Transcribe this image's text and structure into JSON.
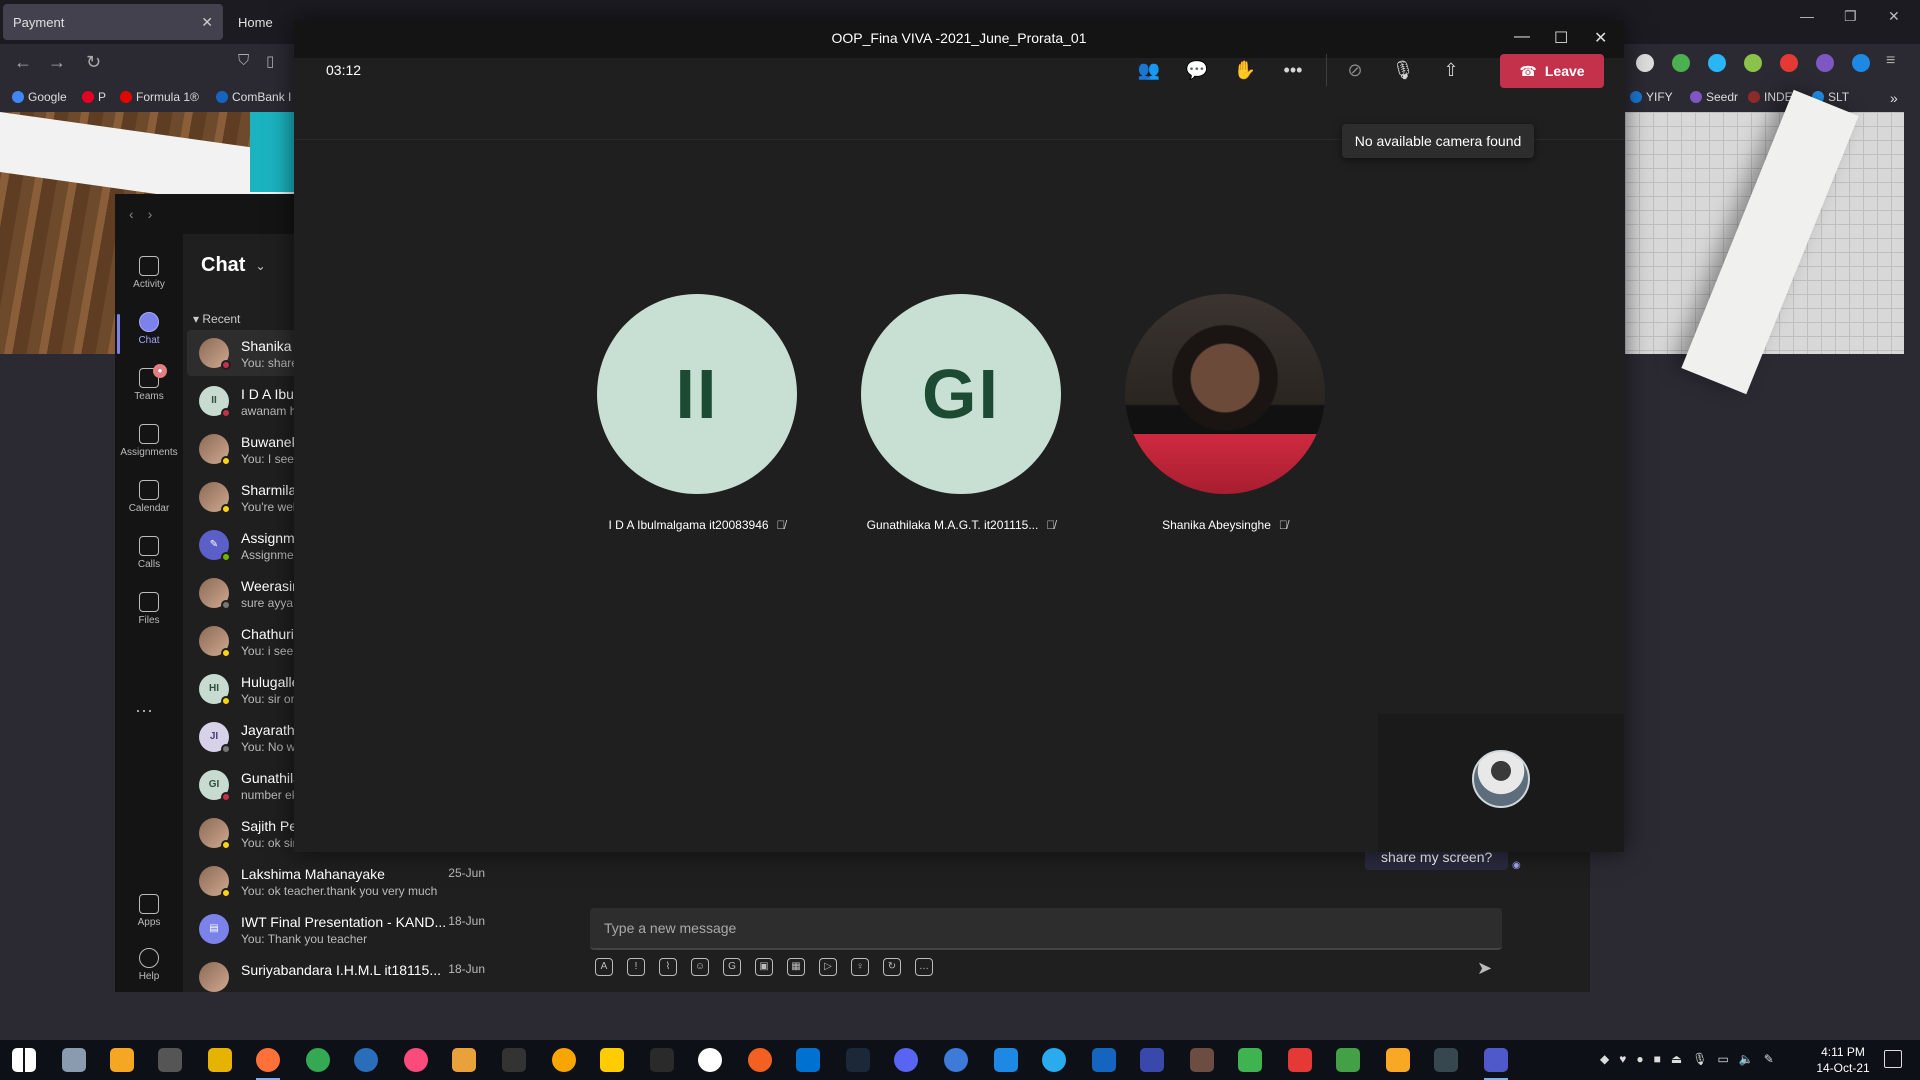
{
  "browser": {
    "tabs": [
      {
        "label": "Payment",
        "active": true
      },
      {
        "label": "Home",
        "active": false
      }
    ],
    "bookmarks_left": [
      "Google",
      "P",
      "Formula 1®",
      "ComBank I"
    ],
    "bookmarks_right": [
      "YIFY",
      "Seedr",
      "INDEX",
      "SLT"
    ]
  },
  "teams": {
    "rail": [
      {
        "label": "Activity"
      },
      {
        "label": "Chat"
      },
      {
        "label": "Teams"
      },
      {
        "label": "Assignments"
      },
      {
        "label": "Calendar"
      },
      {
        "label": "Calls"
      },
      {
        "label": "Files"
      }
    ],
    "rail_more": "···",
    "rail_bottom": [
      {
        "label": "Apps"
      },
      {
        "label": "Help"
      }
    ],
    "chat_title": "Chat",
    "recent_label": "Recent",
    "chats": [
      {
        "name": "Shanika A",
        "preview": "You: share",
        "initials": "",
        "date": ""
      },
      {
        "name": "I D A Ibu",
        "preview": "awanam h",
        "initials": "II",
        "date": ""
      },
      {
        "name": "Buwanek",
        "preview": "You: I see .",
        "initials": "",
        "date": ""
      },
      {
        "name": "Sharmila",
        "preview": "You're wel",
        "initials": "",
        "date": ""
      },
      {
        "name": "Assignme",
        "preview": "Assignmer",
        "initials": "",
        "date": ""
      },
      {
        "name": "Weerasin",
        "preview": "sure ayya",
        "initials": "",
        "date": ""
      },
      {
        "name": "Chathuril",
        "preview": "You: i see,T",
        "initials": "",
        "date": ""
      },
      {
        "name": "Hulugalle",
        "preview": "You: sir on",
        "initials": "HI",
        "date": ""
      },
      {
        "name": "Jayarathr",
        "preview": "You: No w",
        "initials": "JI",
        "date": ""
      },
      {
        "name": "Gunathila",
        "preview": "number ek",
        "initials": "GI",
        "date": ""
      },
      {
        "name": "Sajith Per",
        "preview": "You: ok sir",
        "initials": "",
        "date": ""
      },
      {
        "name": "Lakshima Mahanayake",
        "preview": "You: ok teacher.thank you very much",
        "initials": "",
        "date": "25-Jun"
      },
      {
        "name": "IWT Final Presentation - KAND...",
        "preview": "You: Thank you teacher",
        "initials": "",
        "date": "18-Jun"
      },
      {
        "name": "Suriyabandara I.H.M.L it18115...",
        "preview": "",
        "initials": "",
        "date": "18-Jun"
      }
    ],
    "bubble_text": "share my screen?",
    "composer_placeholder": "Type a new message"
  },
  "meeting": {
    "title": "OOP_Fina VIVA -2021_June_Prorata_01",
    "timer": "03:12",
    "leave_label": "Leave",
    "tooltip": "No available camera found",
    "participants": [
      {
        "initials": "II",
        "name": "I D A Ibulmalgama it20083946"
      },
      {
        "initials": "GI",
        "name": "Gunathilaka M.A.G.T. it201115..."
      },
      {
        "initials": "",
        "name": "Shanika Abeysinghe"
      }
    ]
  },
  "taskbar": {
    "time": "4:11 PM",
    "date": "14-Oct-21"
  },
  "colors": {
    "leave": "#c4314b",
    "accent": "#7b83eb",
    "avatar_bg": "#c7e0d3"
  }
}
